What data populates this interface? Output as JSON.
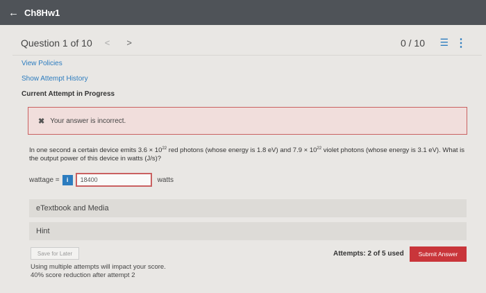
{
  "header": {
    "back_icon": "←",
    "title": "Ch8Hw1"
  },
  "question_bar": {
    "label": "Question 1 of 10",
    "prev_icon": "<",
    "next_icon": ">",
    "score": "0 / 10",
    "list_icon": "☰",
    "more_icon": "⋮"
  },
  "links": {
    "view_policies": "View Policies",
    "show_history": "Show Attempt History",
    "current_attempt": "Current Attempt in Progress"
  },
  "alert": {
    "icon": "✖",
    "message": "Your answer is incorrect."
  },
  "question": {
    "part1": "In one second a certain device emits 3.6 × 10",
    "exp1": "22",
    "part2": " red photons (whose energy is 1.8 eV) and 7.9 × 10",
    "exp2": "22",
    "part3": " violet photons (whose energy is 3.1 eV). What is the output power of this device in watts (J/s)?"
  },
  "answer": {
    "label": "wattage =",
    "info_icon": "i",
    "value": "18400",
    "unit": "watts"
  },
  "panels": {
    "etextbook": "eTextbook and Media",
    "hint": "Hint"
  },
  "footer": {
    "save_label": "Save for Later",
    "attempts": "Attempts: 2 of 5 used",
    "submit_label": "Submit Answer",
    "note_line1": "Using multiple attempts will impact your score.",
    "note_line2": "40% score reduction after attempt 2"
  },
  "colors": {
    "topbar": "#4f5358",
    "link": "#2c7cbf",
    "error": "#c96060",
    "submit": "#c9353a"
  }
}
